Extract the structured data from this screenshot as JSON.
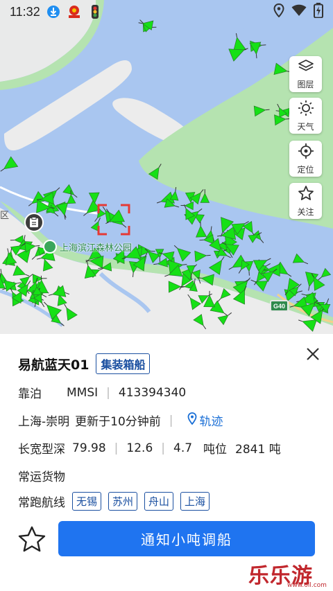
{
  "status_bar": {
    "time": "11:32",
    "left_icons": [
      "download-icon",
      "app-badge-icon",
      "traffic-light-icon"
    ],
    "right_icons": [
      "location-icon",
      "wifi-icon",
      "battery-charging-icon"
    ]
  },
  "map": {
    "buttons": [
      {
        "id": "layers",
        "label": "图层",
        "icon": "layers-icon"
      },
      {
        "id": "weather",
        "label": "天气",
        "icon": "sun-icon"
      },
      {
        "id": "locate",
        "label": "定位",
        "icon": "crosshair-icon"
      },
      {
        "id": "follow",
        "label": "关注",
        "icon": "star-icon"
      }
    ],
    "park_label": "上海滨江森林公园",
    "district_label": "区",
    "highway_label": "G40",
    "colors": {
      "water": "#a9c6f0",
      "land": "#ededed",
      "greenbelt": "#b5e3b0",
      "ship": "#16e016"
    }
  },
  "ship": {
    "name": "易航蓝天01",
    "type": "集装箱船",
    "status": "靠泊",
    "mmsi_label": "MMSI",
    "mmsi": "413394340",
    "route": "上海-崇明",
    "updated": "更新于10分钟前",
    "track_label": "轨迹",
    "dims_label": "长宽型深",
    "length": "79.98",
    "width": "12.6",
    "depth": "4.7",
    "tonnage_label": "吨位",
    "tonnage": "2841 吨",
    "cargo_label": "常运货物",
    "routes_label": "常跑航线",
    "routes": [
      "无锡",
      "苏州",
      "舟山",
      "上海"
    ],
    "notify_button": "通知小吨调船"
  },
  "watermark": {
    "text": "乐乐游戏",
    "url": "www.6ll.com"
  }
}
